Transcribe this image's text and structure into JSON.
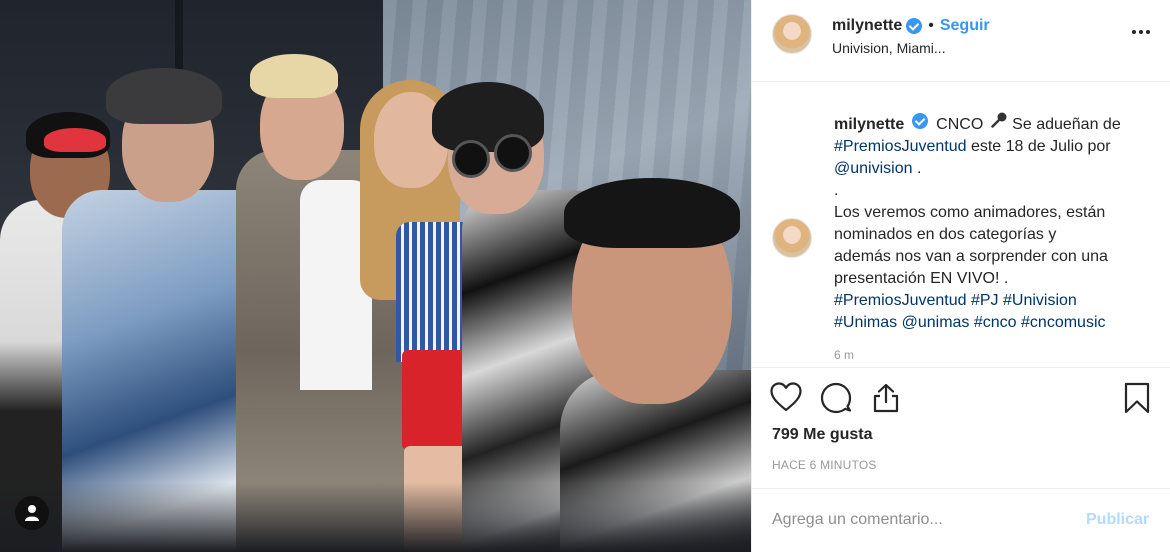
{
  "post": {
    "username": "milynette",
    "follow_label": "Seguir",
    "separator": "•",
    "location": "Univision, Miami...",
    "more_icon": "more-options-icon"
  },
  "caption": {
    "username": "milynette",
    "l1_text": "CNCO",
    "l1_rest": " Se adueñan de",
    "l2_tag": "#PremiosJuventud",
    "l2_rest": " este 18 de Julio por",
    "l3_tag": "@univision",
    "l3_rest": " .",
    "l4": ".",
    "l5": "Los veremos como animadores, están",
    "l6": "nominados en dos categorías y",
    "l7": "además nos van a sorprender con una",
    "l8": "presentación EN VIVO! .",
    "l9_tag1": "#PremiosJuventud",
    "l9_tag2": "#PJ",
    "l9_tag3": "#Univision",
    "l10_tag1": "#Unimas",
    "l10_tag2": "@unimas",
    "l10_tag3": "#cnco",
    "l10_tag4": "#cncomusic",
    "time": "6 m"
  },
  "actions": {
    "icons": [
      "heart-icon",
      "comment-icon",
      "share-icon",
      "bookmark-icon"
    ],
    "likes": "799 Me gusta",
    "posted_ago": "HACE 6 MINUTOS"
  },
  "comment": {
    "placeholder": "Agrega un comentario...",
    "publish_label": "Publicar"
  },
  "colors": {
    "accent": "#3897f0",
    "hashtag": "#003569",
    "muted": "#999999",
    "publish_disabled": "#b3dbff"
  }
}
